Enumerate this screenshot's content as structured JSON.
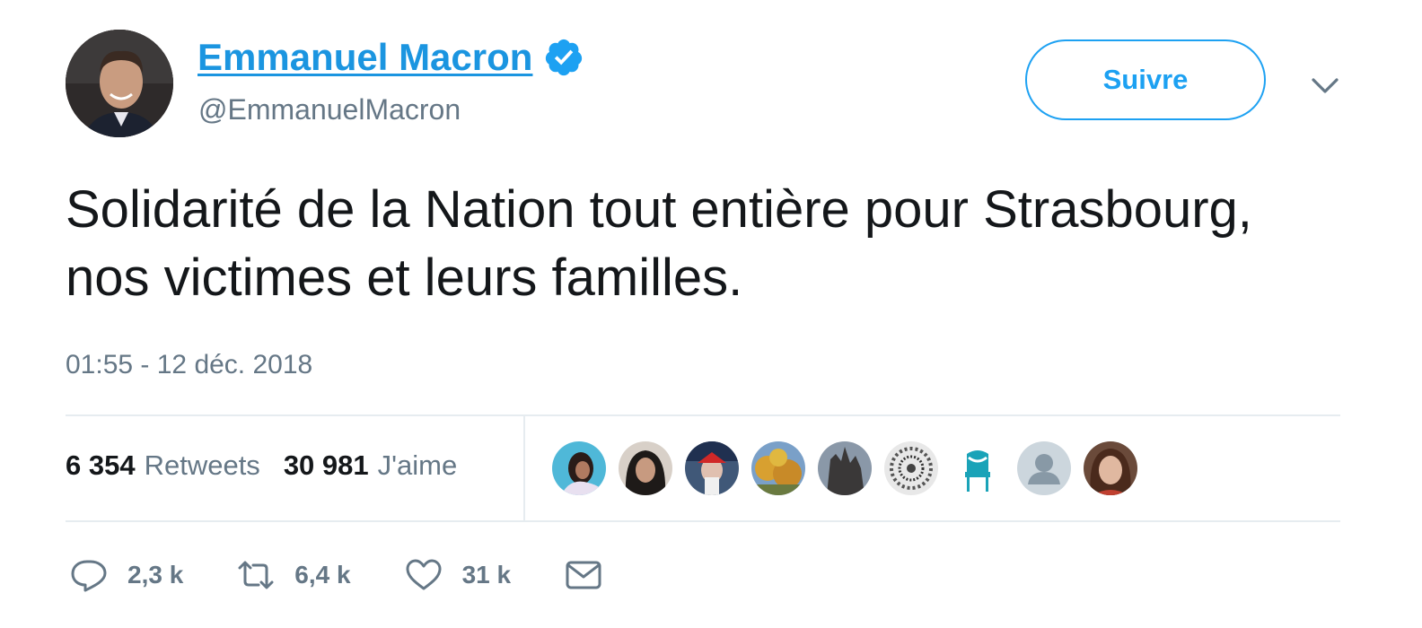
{
  "author": {
    "display_name": "Emmanuel Macron",
    "handle": "@EmmanuelMacron",
    "verified_icon": "verified-badge-icon"
  },
  "follow_button_label": "Suivre",
  "tweet": {
    "text": "Solidarité de la Nation tout entière pour Strasbourg, nos victimes et leurs familles.",
    "timestamp": "01:55 - 12 déc. 2018"
  },
  "stats": {
    "retweets_count": "6 354",
    "retweets_label": "Retweets",
    "likes_count": "30 981",
    "likes_label": "J'aime"
  },
  "actions": {
    "reply_count": "2,3 k",
    "retweet_count": "6,4 k",
    "like_count": "31 k"
  },
  "colors": {
    "link_blue": "#1b95e0",
    "accent": "#1da1f2",
    "muted": "#657786",
    "divider": "#e6ecf0"
  }
}
